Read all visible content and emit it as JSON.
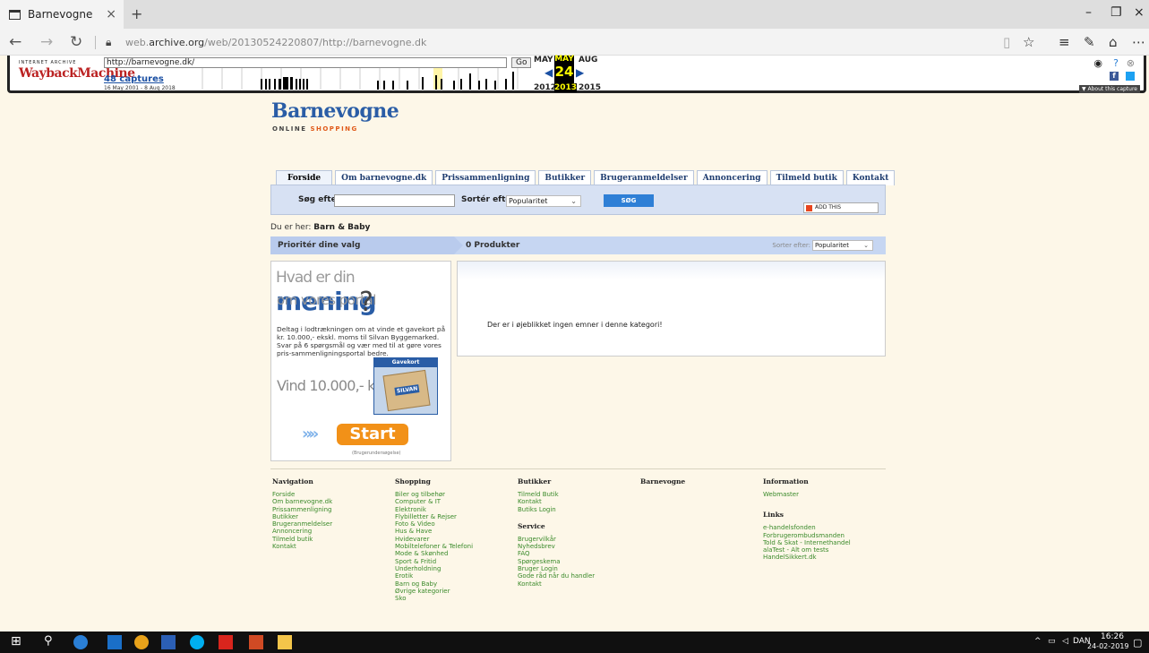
{
  "browser": {
    "tab_title": "Barnevogne",
    "tab_close": "×",
    "new_tab": "+",
    "win_minimize": "–",
    "win_restore": "❐",
    "win_close": "×",
    "url_gray_prefix": "web.",
    "url_domain": "archive.org",
    "url_rest": "/web/20130524220807/http://barnevogne.dk"
  },
  "wayback": {
    "logo_top": "INTERNET ARCHIVE",
    "logo": "WaybackMachine",
    "url_input": "http://barnevogne.dk/",
    "go": "Go",
    "captures": "48 captures",
    "date_range": "16 May 2001 - 8 Aug 2018",
    "prev_month": "MAY",
    "cur_month": "MAY",
    "next_month": "AUG",
    "day": "24",
    "prev_year": "2012",
    "cur_year": "2013",
    "next_year": "2015",
    "about": "▼ About this capture"
  },
  "site": {
    "logo": "Barnevogne",
    "sub_online": "ONLINE ",
    "sub_shopping": "SHOPPING"
  },
  "nav": {
    "tabs": [
      {
        "label": "Forside"
      },
      {
        "label": "Om barnevogne.dk"
      },
      {
        "label": "Prissammenligning"
      },
      {
        "label": "Butikker"
      },
      {
        "label": "Brugeranmeldelser"
      },
      {
        "label": "Annoncering"
      },
      {
        "label": "Tilmeld butik"
      },
      {
        "label": "Kontakt"
      }
    ]
  },
  "search": {
    "label": "Søg efter:",
    "sort_label": "Sortér efter:",
    "sort_value": "Popularitet",
    "button": "SØG",
    "addthis": "ADD THIS"
  },
  "breadcrumb": {
    "prefix": "Du er her: ",
    "current": "Barn & Baby"
  },
  "listing": {
    "prioritize": "Prioritér dine valg",
    "count": "0 Produkter",
    "sort_label": "Sorter efter:",
    "sort_value": "Popularitet",
    "empty_message": "Der er i øjeblikket ingen emner i denne kategori!"
  },
  "banner": {
    "h1_a": "Hvad er din ",
    "h1_big": "mening",
    "h2": "om vores portal",
    "question": "?",
    "text": "Deltag i lodtrækningen om at vinde et gavekort på kr. 10.000,- ekskl. moms til Silvan Byggemarked. Svar på 6 spørgsmål og vær med til at gøre vores pris-sammenligningsportal bedre.",
    "vind": "Vind 10.000,- kr.",
    "card_title": "Gavekort",
    "card_brand": "SILVAN",
    "arrows": "»»",
    "start": "Start",
    "note": "(Brugerundersøgelse)"
  },
  "footer": {
    "navigation": {
      "title": "Navigation",
      "links": [
        "Forside",
        "Om barnevogne.dk",
        "Prissammenligning",
        "Butikker",
        "Brugeranmeldelser",
        "Annoncering",
        "Tilmeld butik",
        "Kontakt"
      ]
    },
    "shopping": {
      "title": "Shopping",
      "links": [
        "Biler og tilbehør",
        "Computer & IT",
        "Elektronik",
        "Flybilletter & Rejser",
        "Foto & Video",
        "Hus & Have",
        "Hvidevarer",
        "Mobiltelefoner & Telefoni",
        "Mode & Skønhed",
        "Sport & Fritid",
        "Underholdning",
        "Erotik",
        "Barn og Baby",
        "Øvrige kategorier",
        "Sko"
      ]
    },
    "butikker": {
      "title": "Butikker",
      "links": [
        "Tilmeld Butik",
        "Kontakt",
        "Butiks Login"
      ]
    },
    "service": {
      "title": "Service",
      "links": [
        "Brugervilkår",
        "Nyhedsbrev",
        "FAQ",
        "Spørgeskema",
        "Bruger Login",
        "Gode råd når du handler",
        "Kontakt"
      ]
    },
    "barnevogne": {
      "title": "Barnevogne"
    },
    "information": {
      "title": "Information",
      "links": [
        "Webmaster"
      ]
    },
    "links": {
      "title": "Links",
      "links": [
        "e-handelsfonden",
        "Forbrugerombudsmanden",
        "Told & Skat - Internethandel",
        "alaTest - Alt om tests",
        "HandelSikkert.dk"
      ]
    }
  },
  "taskbar": {
    "lang": "DAN",
    "time": "16:26",
    "date": "24-02-2019"
  },
  "colors": {
    "page_bg": "#fdf7e8",
    "brand_blue": "#2a5da6",
    "link_green": "#3a8a2a",
    "accent_orange": "#f29118"
  }
}
